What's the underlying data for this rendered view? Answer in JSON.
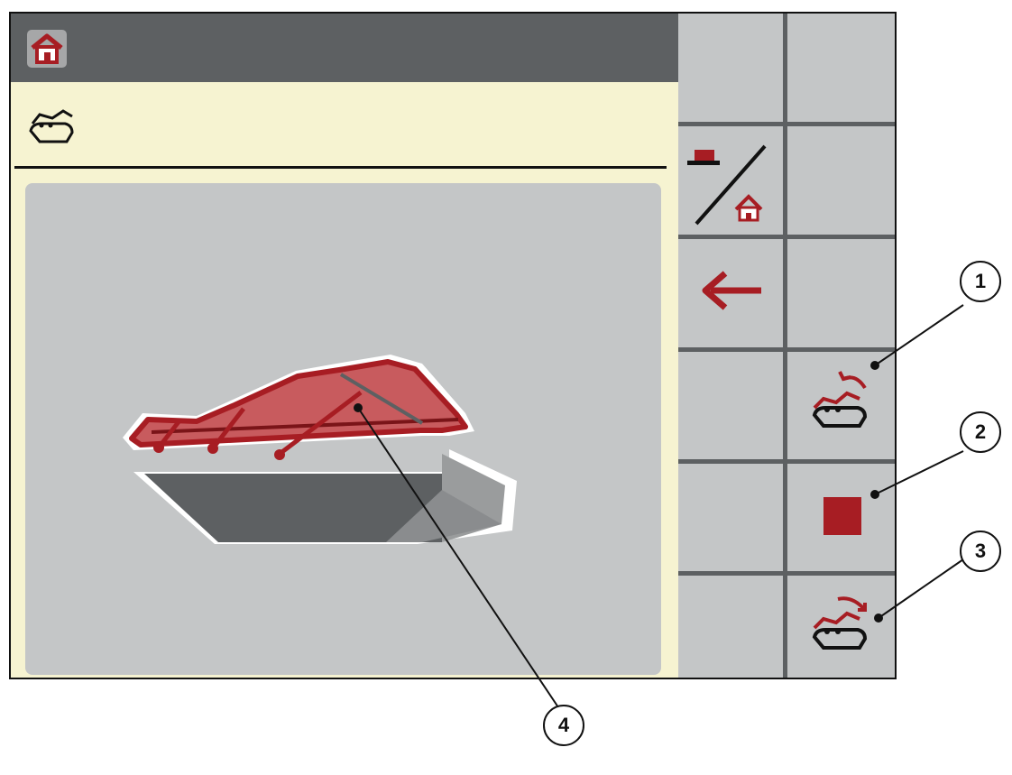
{
  "header": {
    "home_icon": "home-icon"
  },
  "sub_header": {
    "mode_icon": "hopper-cover-icon",
    "title": ""
  },
  "illustration": {
    "subject": "hopper-with-cover",
    "accent_color": "#a71d23"
  },
  "softkeys": {
    "switch_home": "hitch-home-toggle-icon",
    "back": "back-arrow-icon",
    "cover_open": "cover-open-icon",
    "stop": "stop-icon",
    "cover_close": "cover-close-icon"
  },
  "callouts": [
    "1",
    "2",
    "3",
    "4"
  ],
  "colors": {
    "header": "#5d6062",
    "background": "#f6f3d1",
    "panel": "#c4c6c7",
    "accent": "#a71d23"
  }
}
